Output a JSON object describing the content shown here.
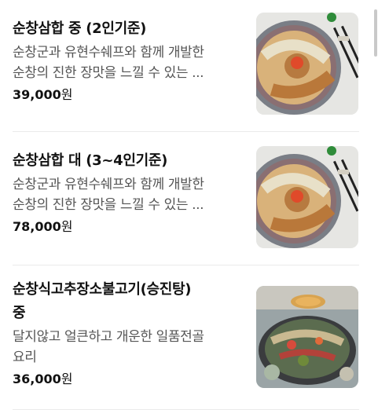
{
  "menu_items": [
    {
      "title": "순창삼합 중 (2인기준)",
      "desc_lines": [
        "순창군과 유현수쉐프와 함께 개발한",
        "순창의 진한 장맛을 느낄 수 있는 ..."
      ],
      "price": "39,000",
      "currency": "원",
      "image_icon": "food-photo-icon"
    },
    {
      "title": "순창삼합 대 (3~4인기준)",
      "desc_lines": [
        "순창군과 유현수쉐프와 함께 개발한",
        "순창의 진한 장맛을 느낄 수 있는 ..."
      ],
      "price": "78,000",
      "currency": "원",
      "image_icon": "food-photo-icon"
    },
    {
      "title_lines": [
        "순창식고추장소불고기(승진탕)",
        "중"
      ],
      "desc_lines": [
        "달지않고 얼큰하고 개운한 일품전골",
        "요리"
      ],
      "price": "36,000",
      "currency": "원",
      "image_icon": "food-photo-icon"
    }
  ]
}
